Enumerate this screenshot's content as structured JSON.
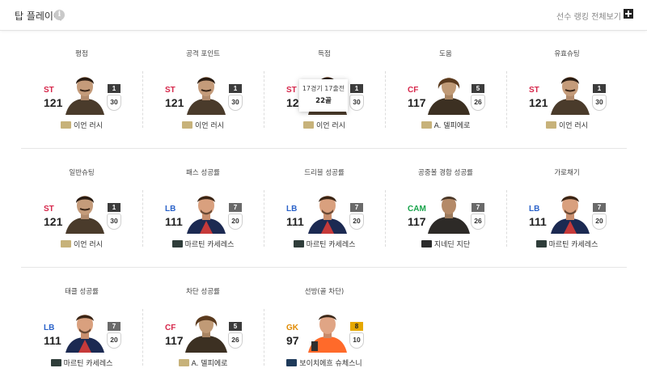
{
  "header": {
    "title": "탑 플레이어",
    "view_all": "선수 랭킹 전체보기"
  },
  "colors": {
    "ST": "#d6264a",
    "CF": "#d6264a",
    "LB": "#2a62c9",
    "CAM": "#16a34a",
    "GK": "#e08a00"
  },
  "cards": [
    {
      "category": "평점",
      "pos": "ST",
      "ovr": "121",
      "rank": "1",
      "count": "30",
      "name": "이언 러시",
      "badge": "ICON"
    },
    {
      "category": "공격 포인트",
      "pos": "ST",
      "ovr": "121",
      "rank": "1",
      "count": "30",
      "name": "이언 러시",
      "badge": "ICON"
    },
    {
      "category": "득점",
      "pos": "ST",
      "ovr": "121",
      "rank": "1",
      "count": "30",
      "name": "이언 러시",
      "badge": "ICON"
    },
    {
      "category": "도움",
      "pos": "CF",
      "ovr": "117",
      "rank": "5",
      "count": "26",
      "name": "A. 델피에로",
      "badge": "ICON"
    },
    {
      "category": "유효슈팅",
      "pos": "ST",
      "ovr": "121",
      "rank": "1",
      "count": "30",
      "name": "이언 러시",
      "badge": "ICON"
    },
    {
      "category": "일반슈팅",
      "pos": "ST",
      "ovr": "121",
      "rank": "1",
      "count": "30",
      "name": "이언 러시",
      "badge": "ICON"
    },
    {
      "category": "패스 성공률",
      "pos": "LB",
      "ovr": "111",
      "rank": "7",
      "count": "20",
      "name": "마르틴 카세레스",
      "badge": "DIC"
    },
    {
      "category": "드리블 성공률",
      "pos": "LB",
      "ovr": "111",
      "rank": "7",
      "count": "20",
      "name": "마르틴 카세레스",
      "badge": "DIC"
    },
    {
      "category": "공중볼 경합 성공률",
      "pos": "CAM",
      "ovr": "117",
      "rank": "7",
      "count": "26",
      "name": "지네딘 지단",
      "badge": "BTB"
    },
    {
      "category": "가로채기",
      "pos": "LB",
      "ovr": "111",
      "rank": "7",
      "count": "20",
      "name": "마르틴 카세레스",
      "badge": "DIC"
    },
    {
      "category": "태클 성공률",
      "pos": "LB",
      "ovr": "111",
      "rank": "7",
      "count": "20",
      "name": "마르틴 카세레스",
      "badge": "DIC"
    },
    {
      "category": "차단 성공률",
      "pos": "CF",
      "ovr": "117",
      "rank": "5",
      "count": "26",
      "name": "A. 델피에로",
      "badge": "ICON"
    },
    {
      "category": "선방(골 차단)",
      "pos": "GK",
      "ovr": "97",
      "rank": "8",
      "count": "10",
      "name": "보이치에흐 슈체스니",
      "badge": "EBS"
    }
  ],
  "tooltip": {
    "line1": "17경기 17출전",
    "line2": "22골"
  }
}
